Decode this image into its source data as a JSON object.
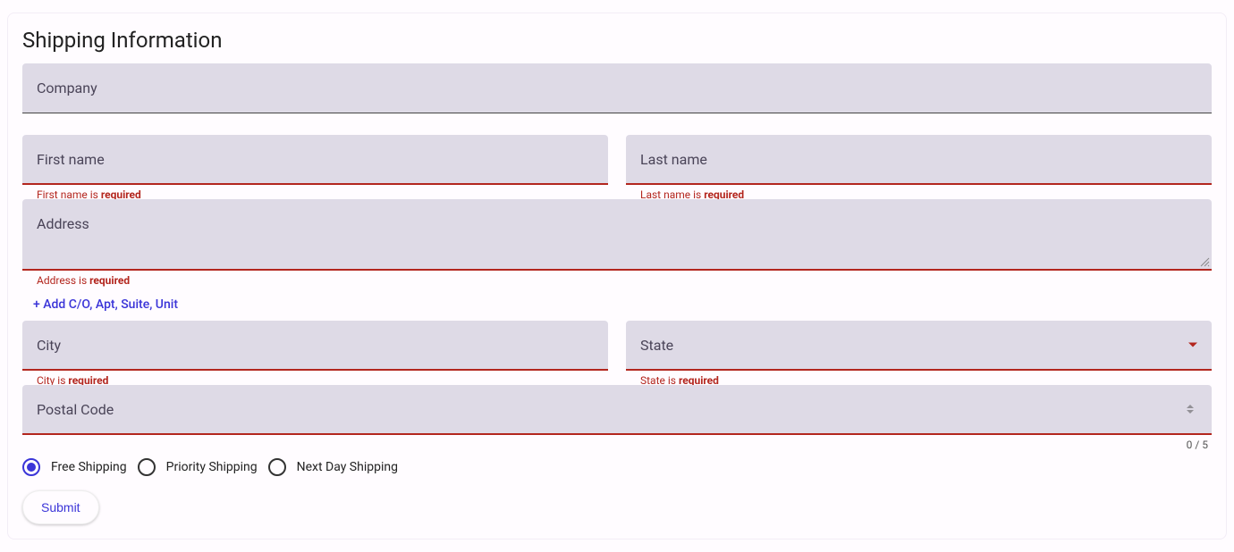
{
  "title": "Shipping Information",
  "fields": {
    "company": {
      "label": "Company"
    },
    "firstName": {
      "label": "First name",
      "errorPrefix": "First name is ",
      "errorBold": "required"
    },
    "lastName": {
      "label": "Last name",
      "errorPrefix": "Last name is ",
      "errorBold": "required"
    },
    "address": {
      "label": "Address",
      "errorPrefix": "Address is ",
      "errorBold": "required"
    },
    "city": {
      "label": "City",
      "errorPrefix": "City is ",
      "errorBold": "required"
    },
    "state": {
      "label": "State",
      "errorPrefix": "State is ",
      "errorBold": "required"
    },
    "postalCode": {
      "label": "Postal Code",
      "counter": "0 / 5"
    }
  },
  "addLine": "+ Add C/O, Apt, Suite, Unit",
  "shippingOptions": [
    {
      "label": "Free Shipping",
      "selected": true
    },
    {
      "label": "Priority Shipping",
      "selected": false
    },
    {
      "label": "Next Day Shipping",
      "selected": false
    }
  ],
  "submitLabel": "Submit"
}
